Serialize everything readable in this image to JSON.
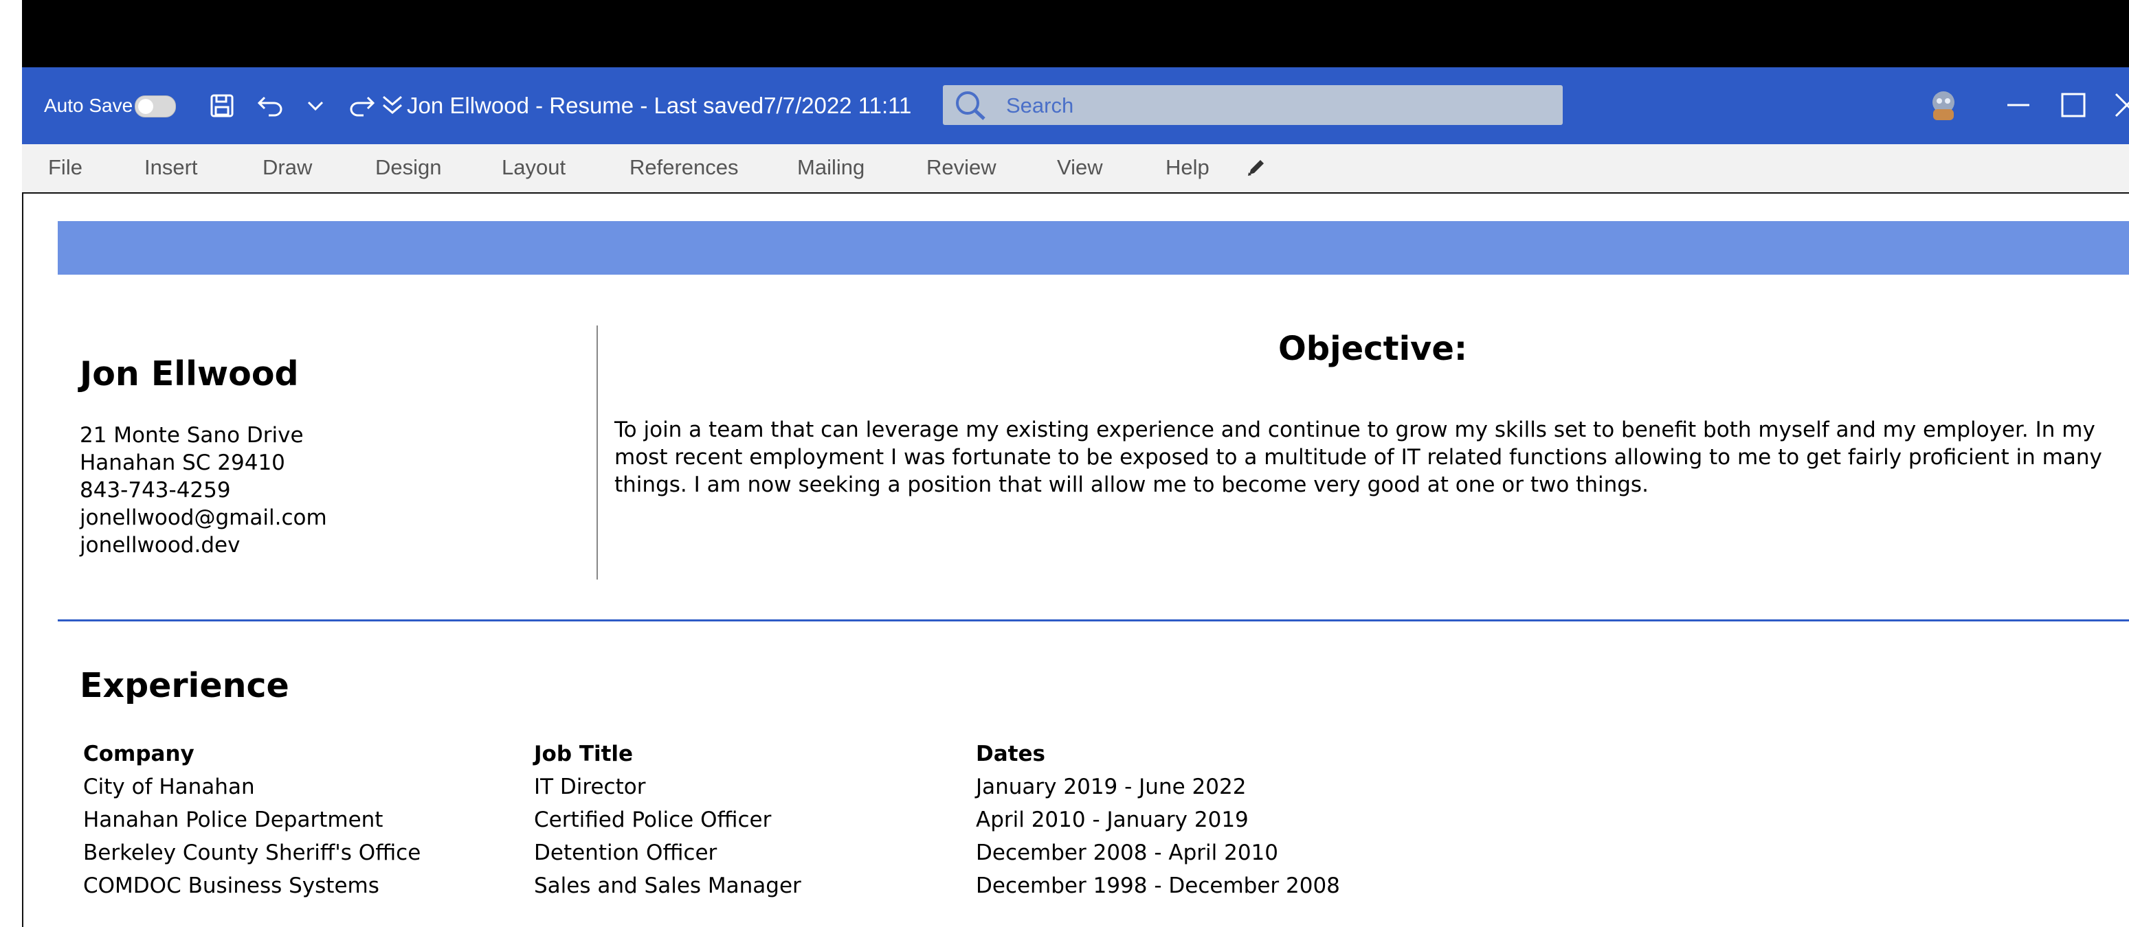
{
  "colors": {
    "title_bar": "#2e5bc6",
    "banner": "#6d92e3",
    "rule": "#2e5bc6",
    "menu_bg": "#f2f2f2",
    "search_bg": "#b8c4d6"
  },
  "titlebar": {
    "autosave_label": "Auto Save",
    "autosave_on": false,
    "document_title": "Jon Ellwood - Resume - Last saved7/7/2022 11:11",
    "icons": [
      "toggle-switch",
      "save-icon",
      "undo-icon",
      "dropdown-chevron-icon",
      "redo-icon",
      "customize-toolbar-icon"
    ]
  },
  "search": {
    "placeholder": "Search"
  },
  "window_controls": [
    "avatar",
    "minimize-icon",
    "maximize-icon",
    "close-icon"
  ],
  "menu": {
    "items": [
      "File",
      "Insert",
      "Draw",
      "Design",
      "Layout",
      "References",
      "Mailing",
      "Review",
      "View",
      "Help"
    ]
  },
  "resume": {
    "name": "Jon Ellwood",
    "contact": {
      "street": "21 Monte Sano Drive",
      "city": "Hanahan SC 29410",
      "phone": "843-743-4259",
      "email": "jonellwood@gmail.com",
      "website": "jonellwood.dev"
    },
    "objective": {
      "heading": "Objective:",
      "body": "To join a team that can leverage my existing experience and continue to grow my skills set to benefit both myself and my employer. In my most recent employment I was fortunate to be exposed to a multitude of IT related functions allowing to me to get fairly proficient in many things. I am now seeking a position that will allow me to become very good at one or two things."
    },
    "experience": {
      "heading": "Experience",
      "columns": [
        "Company",
        "Job Title",
        "Dates"
      ],
      "rows": [
        [
          "City of Hanahan",
          "IT Director",
          "January 2019 - June 2022"
        ],
        [
          "Hanahan Police Department",
          "Certified Police Officer",
          "April 2010 - January 2019"
        ],
        [
          "Berkeley County Sheriff's Office",
          "Detention Officer",
          "December 2008 - April 2010"
        ],
        [
          "COMDOC Business Systems",
          "Sales and Sales Manager",
          "December 1998 - December 2008"
        ]
      ]
    }
  }
}
